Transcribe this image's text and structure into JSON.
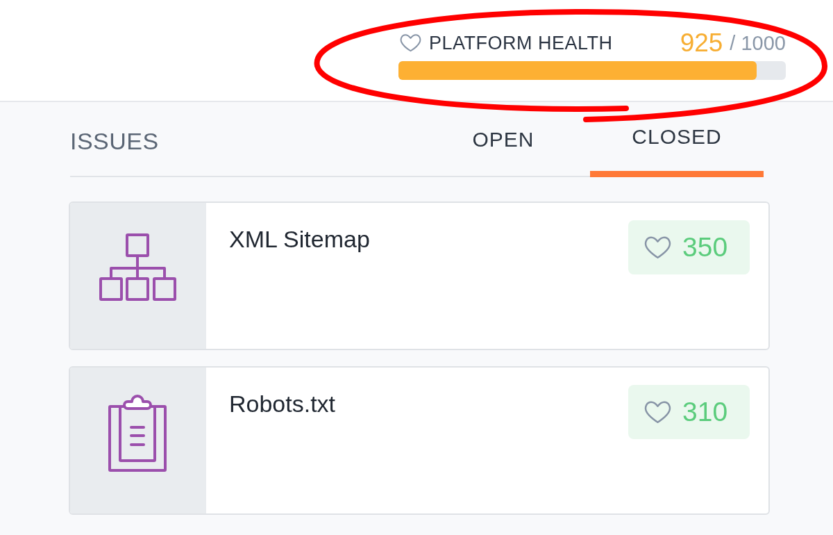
{
  "header": {
    "health": {
      "label": "PLATFORM HEALTH",
      "score": "925",
      "max": "/ 1000",
      "level": 0.925
    }
  },
  "issues": {
    "title": "ISSUES",
    "tabs": [
      {
        "label": "OPEN",
        "selected": false
      },
      {
        "label": "CLOSED",
        "selected": true
      }
    ],
    "items": [
      {
        "kind": "sitemap",
        "title": "XML Sitemap",
        "score": "350"
      },
      {
        "kind": "robots",
        "title": "Robots.txt",
        "score": "310"
      }
    ]
  }
}
